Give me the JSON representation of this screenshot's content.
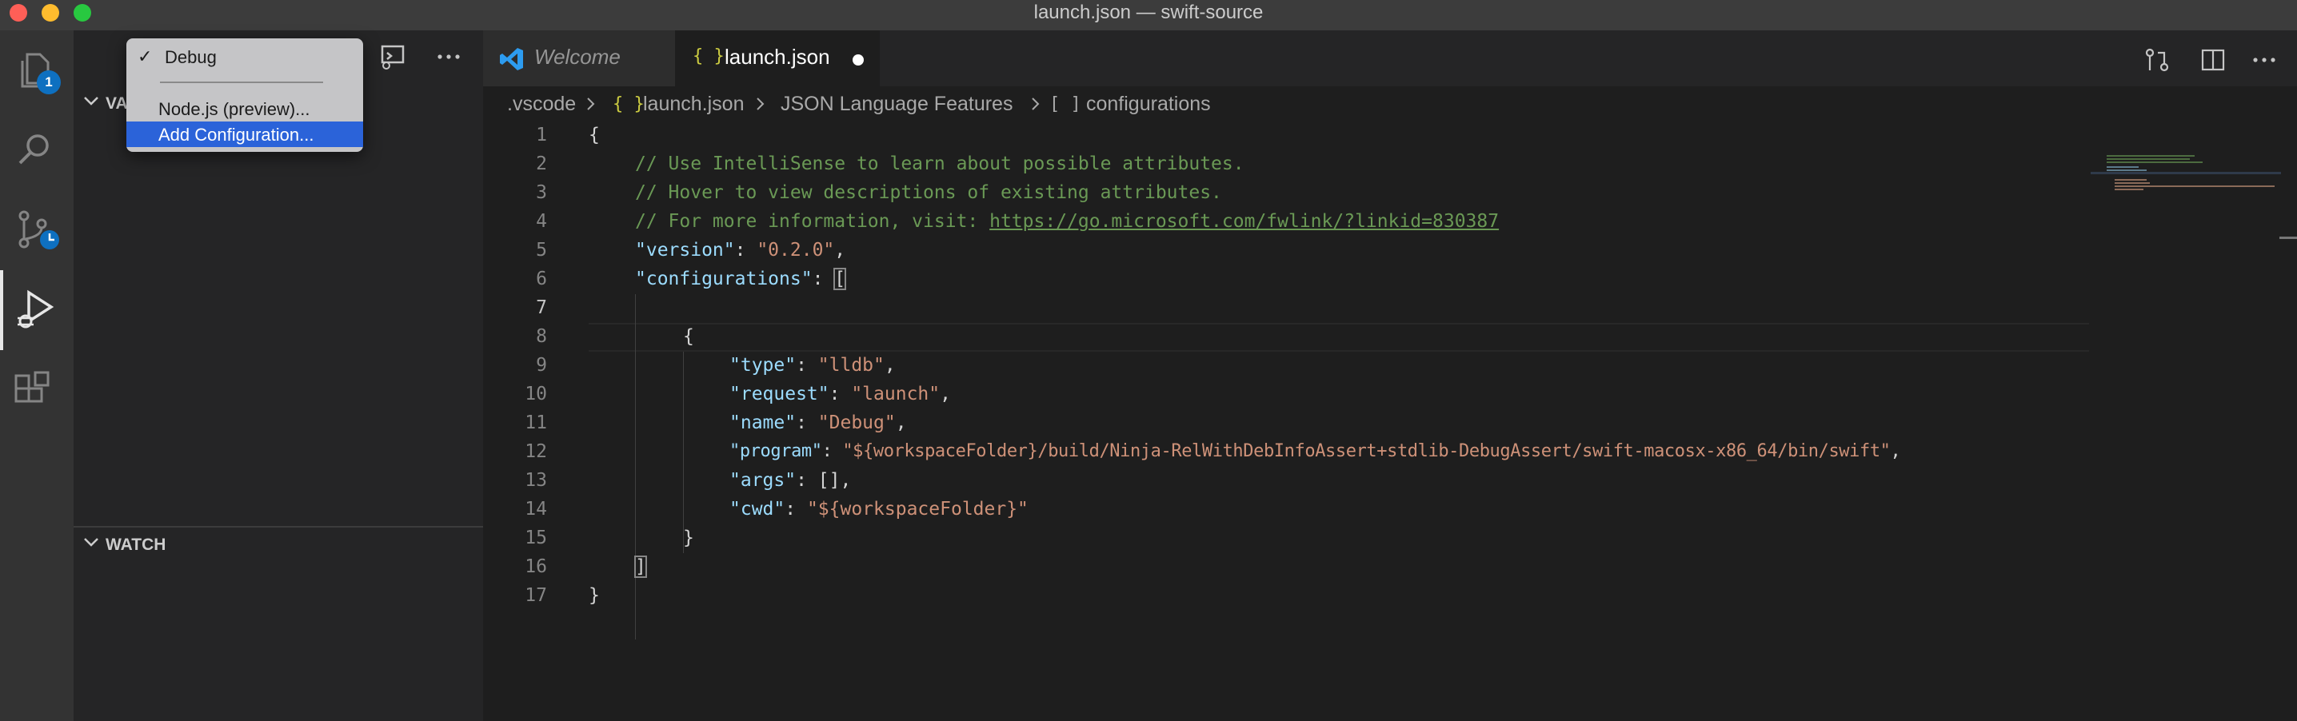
{
  "window": {
    "title": "launch.json — swift-source"
  },
  "activity_bar": {
    "items": [
      {
        "name": "explorer",
        "icon": "files-icon",
        "badge": "1"
      },
      {
        "name": "search",
        "icon": "search-icon"
      },
      {
        "name": "source-control",
        "icon": "source-control-icon"
      },
      {
        "name": "run-and-debug",
        "icon": "run-debug-icon",
        "active": true
      },
      {
        "name": "extensions",
        "icon": "extensions-icon"
      }
    ]
  },
  "sidebar": {
    "sections": {
      "variables": "VA",
      "watch": "WATCH"
    }
  },
  "launch_dropdown": {
    "selected_check": "✓",
    "items": [
      "Debug",
      "Node.js (preview)...",
      "Add Configuration..."
    ]
  },
  "tabs": [
    {
      "label": "Welcome",
      "icon": "vscode-icon"
    },
    {
      "label": "launch.json",
      "icon_text": "{ }",
      "active": true,
      "dirty": true
    }
  ],
  "breadcrumb": {
    "items": [
      ".vscode",
      "launch.json",
      "JSON Language Features",
      "configurations"
    ],
    "icon_json": "{ }",
    "icon_array": "[ ]",
    "separator": ">"
  },
  "editor": {
    "line_numbers": [
      "1",
      "2",
      "3",
      "4",
      "5",
      "6",
      "7",
      "8",
      "9",
      "10",
      "11",
      "12",
      "13",
      "14",
      "15",
      "16",
      "17"
    ],
    "text": {
      "l1_brace": "{",
      "l2_comment": "// Use IntelliSense to learn about possible attributes.",
      "l3_comment": "// Hover to view descriptions of existing attributes.",
      "l4_comment": "// For more information, visit: ",
      "l4_link": "https://go.microsoft.com/fwlink/?linkid=830387",
      "l5_key": "\"version\"",
      "l5_value": "\"0.2.0\"",
      "l6_key": "\"configurations\"",
      "l6_bracket": "[",
      "l8_brace": "{",
      "l9_key": "\"type\"",
      "l9_value": "\"lldb\"",
      "l10_key": "\"request\"",
      "l10_value": "\"launch\"",
      "l11_key": "\"name\"",
      "l11_value": "\"Debug\"",
      "l12_key": "\"program\"",
      "l12_value": "\"${workspaceFolder}/build/Ninja-RelWithDebInfoAssert+stdlib-DebugAssert/swift-macosx-x86_64/bin/swift\"",
      "l13_key": "\"args\"",
      "l13_value": "[]",
      "l14_key": "\"cwd\"",
      "l14_value": "\"${workspaceFolder}\"",
      "l15_brace": "}",
      "l16_bracket": "]",
      "l17_brace": "}",
      "colon": ": ",
      "comma": ","
    }
  },
  "colors": {
    "accent_blue": "#0e70c0",
    "selection": "#2b63d9",
    "comment": "#6a9955",
    "json_key": "#9cdcfe",
    "json_string": "#ce9178"
  }
}
